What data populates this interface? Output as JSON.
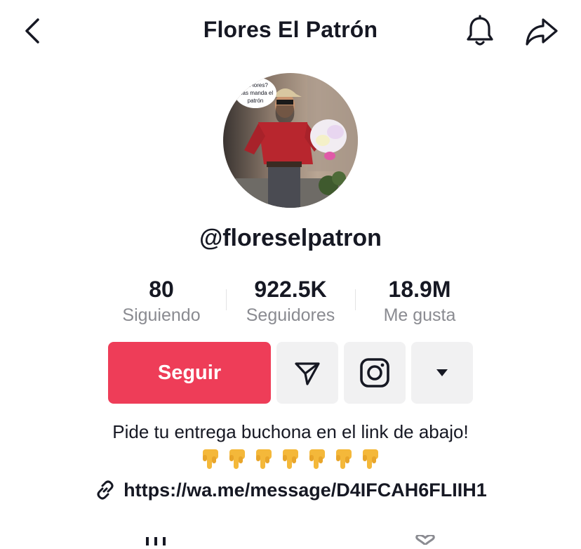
{
  "header": {
    "title": "Flores El Patrón",
    "back_icon": "chevron-left-icon",
    "bell_icon": "bell-icon",
    "share_icon": "share-arrow-icon"
  },
  "profile": {
    "avatar_caption_lines": [
      "¿Flores?",
      "Mas manda el",
      "patrón"
    ],
    "username": "@floreselpatron"
  },
  "stats": [
    {
      "value": "80",
      "label": "Siguiendo"
    },
    {
      "value": "922.5K",
      "label": "Seguidores"
    },
    {
      "value": "18.9M",
      "label": "Me gusta"
    }
  ],
  "actions": {
    "follow_label": "Seguir",
    "message_icon": "send-icon",
    "instagram_icon": "instagram-icon",
    "more_icon": "caret-down-icon"
  },
  "bio": {
    "text": "Pide tu entrega buchona en el link de abajo!",
    "emoji_count": 7,
    "emoji_icon": "pointing-down-hand-icon",
    "link_icon": "link-icon",
    "link": "https://wa.me/message/D4IFCAH6FLIIH1"
  },
  "tabs": {
    "videos_icon": "grid-icon",
    "liked_icon": "heart-icon"
  },
  "colors": {
    "accent": "#ee3d58",
    "text": "#161823",
    "muted": "#8a8b91",
    "button_bg": "#f1f1f2"
  }
}
